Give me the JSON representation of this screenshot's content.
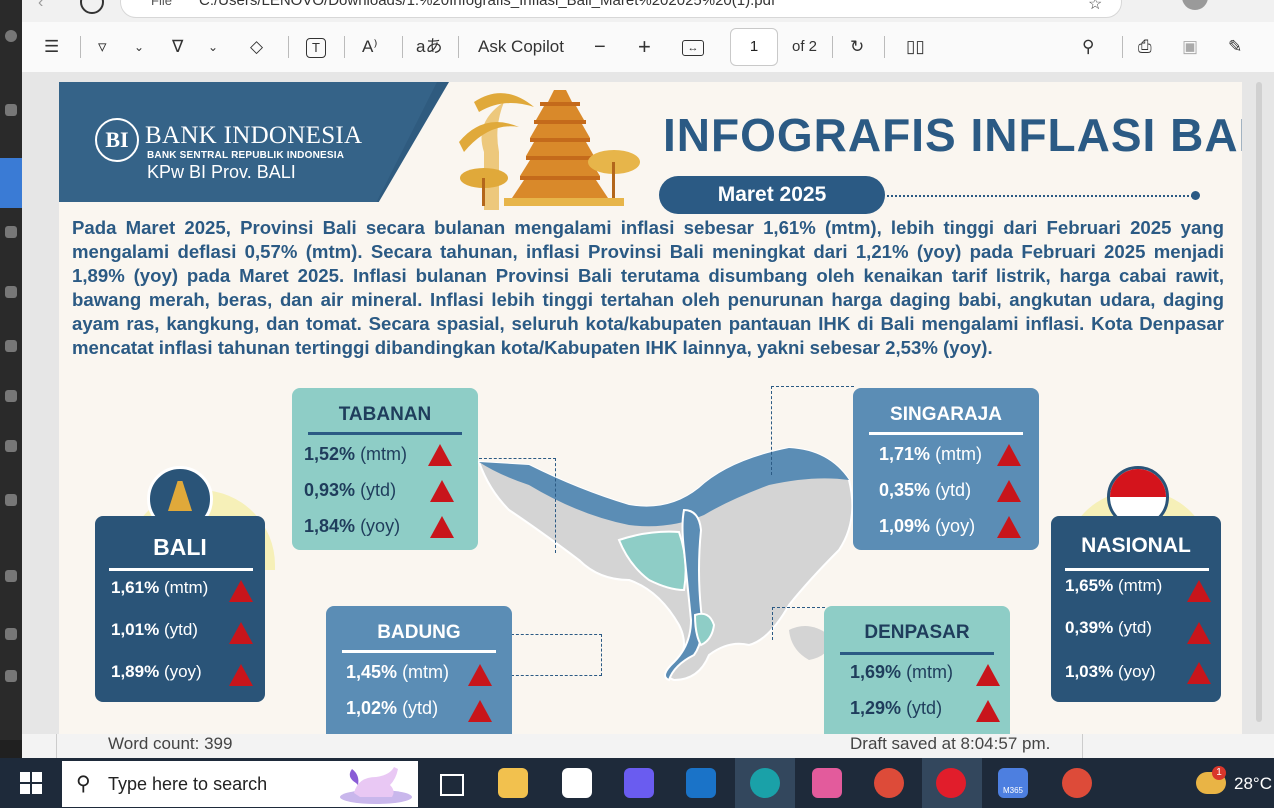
{
  "browser": {
    "url_text": "C:/Users/LENOVO/Downloads/1.%20Infografis_Inflasi_Bali_Maret%202025%20(1).pdf",
    "file_label": "File"
  },
  "toolbar": {
    "ask_copilot": "Ask Copilot",
    "zoom_out": "−",
    "zoom_in": "+",
    "page_current": "1",
    "page_total": "of 2"
  },
  "document": {
    "bank_logo_letters": "BI",
    "bank_name": "BANK INDONESIA",
    "bank_subtitle": "BANK SENTRAL REPUBLIK INDONESIA",
    "bank_office": "KPw BI Prov. BALI",
    "title": "INFOGRAFIS INFLASI BALI",
    "period": "Maret 2025",
    "summary": "Pada Maret 2025, Provinsi Bali secara bulanan mengalami inflasi sebesar 1,61% (mtm), lebih tinggi dari Februari 2025 yang mengalami deflasi 0,57% (mtm). Secara tahunan, inflasi Provinsi Bali meningkat dari 1,21% (yoy) pada Februari 2025 menjadi 1,89% (yoy) pada Maret 2025. Inflasi bulanan Provinsi Bali terutama disumbang oleh kenaikan tarif listrik, harga cabai rawit, bawang merah, beras, dan air mineral. Inflasi lebih tinggi tertahan oleh penurunan harga daging babi, angkutan udara, daging ayam ras, kangkung, dan tomat. Secara spasial, seluruh kota/kabupaten pantauan IHK di Bali mengalami inflasi. Kota Denpasar mencatat inflasi tahunan tertinggi dibandingkan kota/Kabupaten IHK lainnya, yakni sebesar 2,53% (yoy).",
    "regions": {
      "tabanan": {
        "name": "TABANAN",
        "rows": [
          {
            "v": "1,52%",
            "u": "(mtm)"
          },
          {
            "v": "0,93%",
            "u": "(ytd)"
          },
          {
            "v": "1,84%",
            "u": "(yoy)"
          }
        ]
      },
      "singaraja": {
        "name": "SINGARAJA",
        "rows": [
          {
            "v": "1,71%",
            "u": "(mtm)"
          },
          {
            "v": "0,35%",
            "u": "(ytd)"
          },
          {
            "v": "1,09%",
            "u": "(yoy)"
          }
        ]
      },
      "bali": {
        "name": "BALI",
        "rows": [
          {
            "v": "1,61%",
            "u": "(mtm)"
          },
          {
            "v": "1,01%",
            "u": "(ytd)"
          },
          {
            "v": "1,89%",
            "u": "(yoy)"
          }
        ]
      },
      "nasional": {
        "name": "NASIONAL",
        "rows": [
          {
            "v": "1,65%",
            "u": "(mtm)"
          },
          {
            "v": "0,39%",
            "u": "(ytd)"
          },
          {
            "v": "1,03%",
            "u": "(yoy)"
          }
        ]
      },
      "badung": {
        "name": "BADUNG",
        "rows": [
          {
            "v": "1,45%",
            "u": "(mtm)"
          },
          {
            "v": "1,02%",
            "u": "(ytd)"
          }
        ]
      },
      "denpasar": {
        "name": "DENPASAR",
        "rows": [
          {
            "v": "1,69%",
            "u": "(mtm)"
          },
          {
            "v": "1,29%",
            "u": "(ytd)"
          }
        ]
      }
    }
  },
  "status": {
    "word_count": "Word count: 399",
    "draft_saved": "Draft saved at 8:04:57 pm."
  },
  "taskbar": {
    "search_placeholder": "Type here to search",
    "temperature": "28°C",
    "weather_badge": "1",
    "m365_label": "M365"
  },
  "colors": {
    "brand_blue": "#2b5a84",
    "card_teal": "#8ecdc6",
    "card_steel": "#5b8db5",
    "card_navy": "#2a5478",
    "triangle_red": "#c8151b"
  }
}
